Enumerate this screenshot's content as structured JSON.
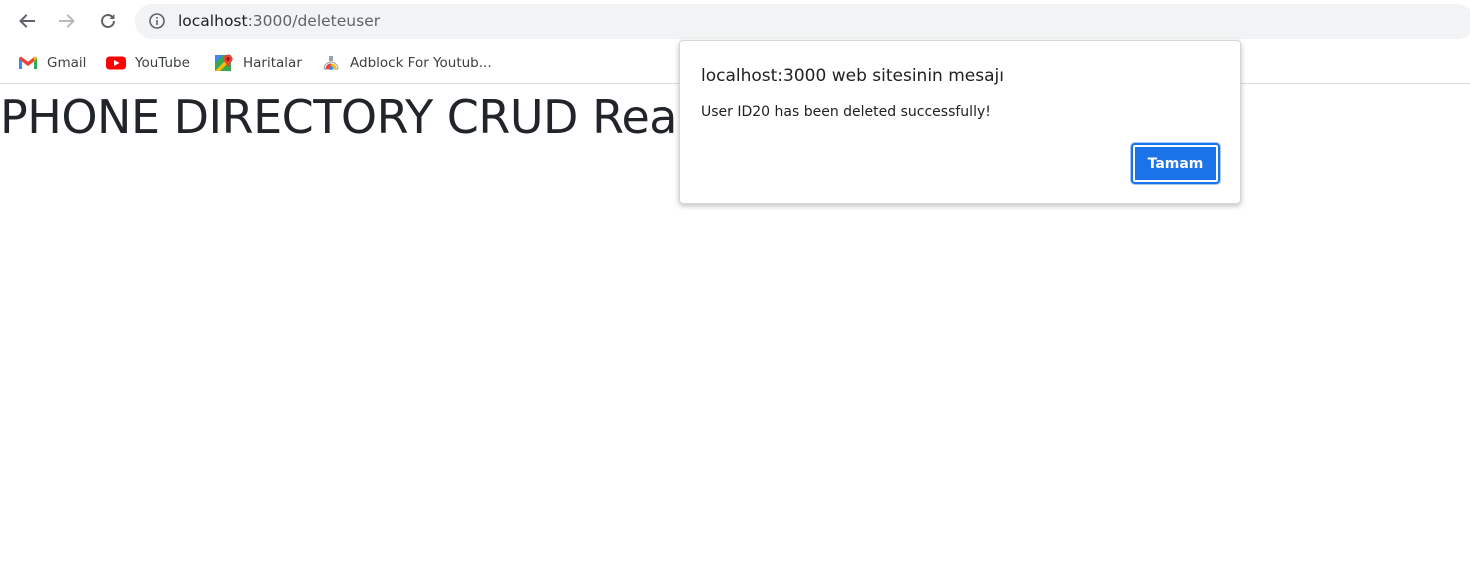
{
  "browser": {
    "back_icon": "arrow-left-icon",
    "forward_icon": "arrow-right-icon",
    "reload_icon": "reload-icon",
    "address": {
      "icon": "info-icon",
      "host": "localhost",
      "path": ":3000/deleteuser"
    },
    "bookmarks": [
      {
        "label": "Gmail",
        "icon": "gmail-icon"
      },
      {
        "label": "YouTube",
        "icon": "youtube-icon"
      },
      {
        "label": "Haritalar",
        "icon": "maps-icon"
      },
      {
        "label": "Adblock For Youtub...",
        "icon": "adblock-icon"
      }
    ]
  },
  "page": {
    "heading": "PHONE DIRECTORY CRUD Rea"
  },
  "dialog": {
    "title": "localhost:3000 web sitesinin mesajı",
    "message": "User ID20 has been deleted successfully!",
    "ok_label": "Tamam"
  },
  "colors": {
    "accent": "#1a73e8",
    "omnibox_bg": "#f1f3f4",
    "heading_text": "#212529"
  }
}
